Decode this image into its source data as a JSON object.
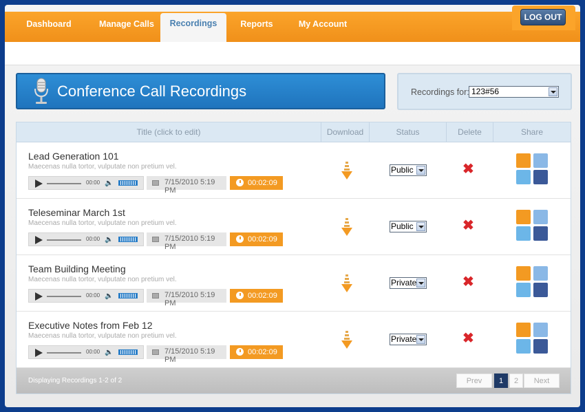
{
  "nav": {
    "tabs": [
      "Dashboard",
      "Manage Calls",
      "Recordings",
      "Reports",
      "My Account"
    ],
    "active_tab": "Recordings",
    "logout_label": "LOG OUT"
  },
  "header": {
    "title": "Conference Call Recordings",
    "icon": "microphone-icon"
  },
  "filter": {
    "label": "Recordings for:",
    "selected": "123#56"
  },
  "table": {
    "columns": [
      "Title (click to edit)",
      "Download",
      "Status",
      "Delete",
      "Share"
    ],
    "rows": [
      {
        "title": "Lead Generation 101",
        "desc": "Maecenas nulla tortor, vulputate non pretium vel.",
        "player_time": "00:00",
        "date": "7/15/2010 5:19 PM",
        "duration": "00:02:09",
        "status": "Public"
      },
      {
        "title": "Teleseminar March 1st",
        "desc": "Maecenas nulla tortor, vulputate non pretium vel.",
        "player_time": "00:00",
        "date": "7/15/2010 5:19 PM",
        "duration": "00:02:09",
        "status": "Public"
      },
      {
        "title": "Team Building Meeting",
        "desc": "Maecenas nulla tortor, vulputate non pretium vel.",
        "player_time": "00:00",
        "date": "7/15/2010 5:19 PM",
        "duration": "00:02:09",
        "status": "Private"
      },
      {
        "title": "Executive Notes from Feb 12",
        "desc": "Maecenas nulla tortor, vulputate non pretium vel.",
        "player_time": "00:00",
        "date": "7/15/2010 5:19 PM",
        "duration": "00:02:09",
        "status": "Private"
      }
    ]
  },
  "footer": {
    "info": "Displaying Recordings 1-2 of 2",
    "prev": "Prev",
    "pages": [
      "1",
      "2"
    ],
    "current_page": "1",
    "next": "Next"
  },
  "colors": {
    "accent_orange": "#f39a22",
    "header_blue": "#2e8ed6",
    "page_bg": "#0d3d8c",
    "delete_red": "#d9262a"
  }
}
